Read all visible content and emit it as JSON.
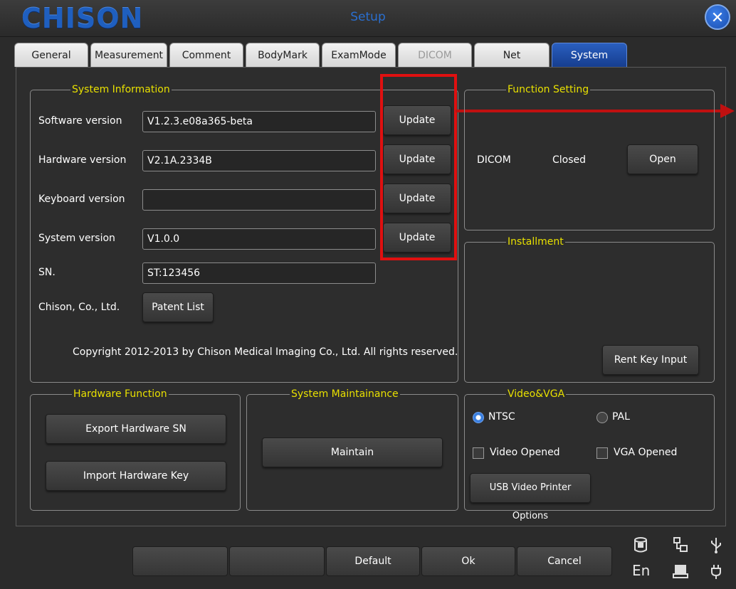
{
  "window": {
    "brand": "CHISON",
    "title": "Setup",
    "close_glyph": "✕"
  },
  "tabs": [
    {
      "label": "General",
      "state": "normal"
    },
    {
      "label": "Measurement",
      "state": "normal"
    },
    {
      "label": "Comment",
      "state": "normal"
    },
    {
      "label": "BodyMark",
      "state": "normal"
    },
    {
      "label": "ExamMode",
      "state": "normal"
    },
    {
      "label": "DICOM",
      "state": "disabled"
    },
    {
      "label": "Net",
      "state": "normal"
    },
    {
      "label": "System",
      "state": "active"
    }
  ],
  "system_info": {
    "legend": "System Information",
    "rows": [
      {
        "label": "Software version",
        "value": "V1.2.3.e08a365-beta",
        "button": "Update"
      },
      {
        "label": "Hardware version",
        "value": "V2.1A.2334B",
        "button": "Update"
      },
      {
        "label": "Keyboard version",
        "value": "",
        "button": "Update"
      },
      {
        "label": "System version",
        "value": "V1.0.0",
        "button": "Update"
      }
    ],
    "sn_label": "SN.",
    "sn_value": "ST:123456",
    "company_label": "Chison, Co., Ltd.",
    "patent_button": "Patent List",
    "copyright": "Copyright 2012-2013 by Chison Medical Imaging Co., Ltd. All rights reserved."
  },
  "function_setting": {
    "legend": "Function Setting",
    "dicom_label": "DICOM",
    "dicom_status": "Closed",
    "open_button": "Open"
  },
  "installment": {
    "legend": "Installment",
    "rent_key_button": "Rent Key Input"
  },
  "hardware_function": {
    "legend": "Hardware Function",
    "export_button": "Export Hardware SN",
    "import_button": "Import Hardware Key"
  },
  "system_maintenance": {
    "legend": "System Maintainance",
    "maintain_button": "Maintain"
  },
  "video_vga": {
    "legend": "Video&VGA",
    "ntsc_label": "NTSC",
    "ntsc_selected": true,
    "pal_label": "PAL",
    "video_opened_label": "Video Opened",
    "video_opened_checked": false,
    "vga_opened_label": "VGA Opened",
    "vga_opened_checked": false,
    "usb_printer_button": "USB Video Printer Options"
  },
  "bottom_bar": {
    "buttons": [
      "",
      "",
      "Default",
      "Ok",
      "Cancel"
    ],
    "status_icons": [
      "database-icon",
      "network-icon",
      "usb-icon",
      "printer-icon",
      "plug-icon"
    ],
    "language": "En"
  },
  "colors": {
    "accent": "#1f4fae",
    "legend": "#e8e000",
    "highlight": "#e01010"
  }
}
